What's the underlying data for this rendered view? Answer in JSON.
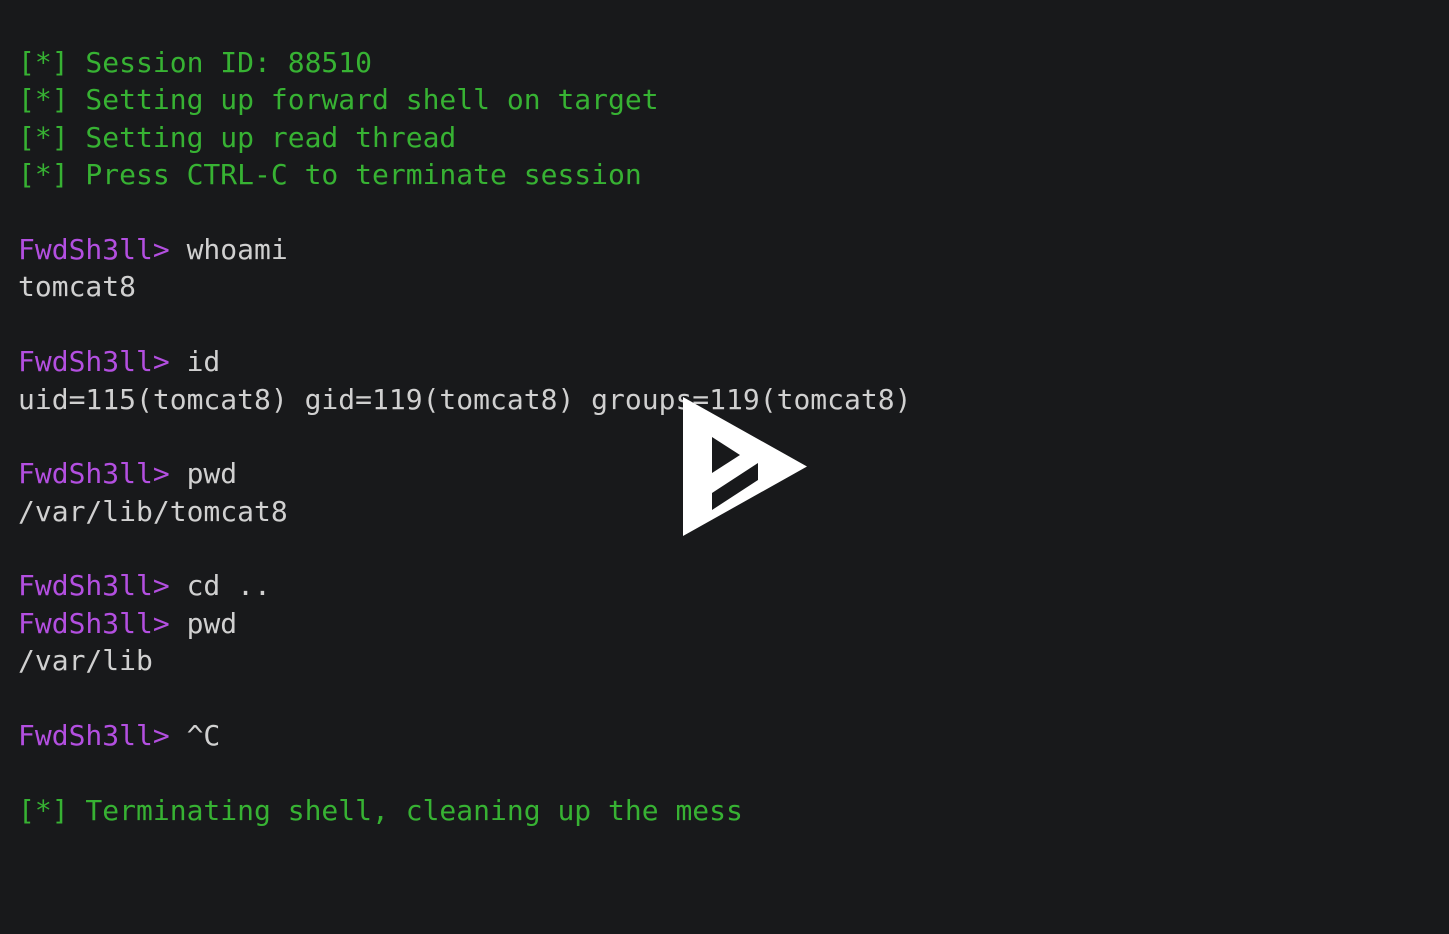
{
  "terminal": {
    "background_color": "#18191b",
    "colors": {
      "info_green": "#37b233",
      "prompt_purple": "#b34fe0",
      "output_white": "#d0d0d0"
    },
    "lines": [
      {
        "id": "line-session-id",
        "segments": [
          {
            "text": "[*] Session ID: 88510",
            "color": "green"
          }
        ]
      },
      {
        "id": "line-setup-forward",
        "segments": [
          {
            "text": "[*] Setting up forward shell on target",
            "color": "green"
          }
        ]
      },
      {
        "id": "line-setup-read",
        "segments": [
          {
            "text": "[*] Setting up read thread",
            "color": "green"
          }
        ]
      },
      {
        "id": "line-press-ctrlc",
        "segments": [
          {
            "text": "[*] Press CTRL-C to terminate session",
            "color": "green"
          }
        ]
      },
      {
        "id": "line-blank-1",
        "segments": [
          {
            "text": " ",
            "color": "white"
          }
        ]
      },
      {
        "id": "line-cmd-whoami",
        "segments": [
          {
            "text": "FwdSh3ll>",
            "color": "purple"
          },
          {
            "text": " whoami",
            "color": "white"
          }
        ]
      },
      {
        "id": "line-out-whoami",
        "segments": [
          {
            "text": "tomcat8",
            "color": "white"
          }
        ]
      },
      {
        "id": "line-blank-2",
        "segments": [
          {
            "text": " ",
            "color": "white"
          }
        ]
      },
      {
        "id": "line-cmd-id",
        "segments": [
          {
            "text": "FwdSh3ll>",
            "color": "purple"
          },
          {
            "text": " id",
            "color": "white"
          }
        ]
      },
      {
        "id": "line-out-id",
        "segments": [
          {
            "text": "uid=115(tomcat8) gid=119(tomcat8) groups=119(tomcat8)",
            "color": "white"
          }
        ]
      },
      {
        "id": "line-blank-3",
        "segments": [
          {
            "text": " ",
            "color": "white"
          }
        ]
      },
      {
        "id": "line-cmd-pwd-1",
        "segments": [
          {
            "text": "FwdSh3ll>",
            "color": "purple"
          },
          {
            "text": " pwd",
            "color": "white"
          }
        ]
      },
      {
        "id": "line-out-pwd-1",
        "segments": [
          {
            "text": "/var/lib/tomcat8",
            "color": "white"
          }
        ]
      },
      {
        "id": "line-blank-4",
        "segments": [
          {
            "text": " ",
            "color": "white"
          }
        ]
      },
      {
        "id": "line-cmd-cd",
        "segments": [
          {
            "text": "FwdSh3ll>",
            "color": "purple"
          },
          {
            "text": " cd ..",
            "color": "white"
          }
        ]
      },
      {
        "id": "line-cmd-pwd-2",
        "segments": [
          {
            "text": "FwdSh3ll>",
            "color": "purple"
          },
          {
            "text": " pwd",
            "color": "white"
          }
        ]
      },
      {
        "id": "line-out-pwd-2",
        "segments": [
          {
            "text": "/var/lib",
            "color": "white"
          }
        ]
      },
      {
        "id": "line-blank-5",
        "segments": [
          {
            "text": " ",
            "color": "white"
          }
        ]
      },
      {
        "id": "line-cmd-ctrlc",
        "segments": [
          {
            "text": "FwdSh3ll>",
            "color": "purple"
          },
          {
            "text": " ^C",
            "color": "white"
          }
        ]
      },
      {
        "id": "line-blank-6",
        "segments": [
          {
            "text": " ",
            "color": "white"
          }
        ]
      },
      {
        "id": "line-terminating",
        "segments": [
          {
            "text": "[*] Terminating shell, cleaning up the mess",
            "color": "green"
          }
        ]
      }
    ]
  },
  "overlay": {
    "play_button": {
      "icon": "play-icon",
      "label": "Play",
      "color": "#ffffff"
    }
  }
}
